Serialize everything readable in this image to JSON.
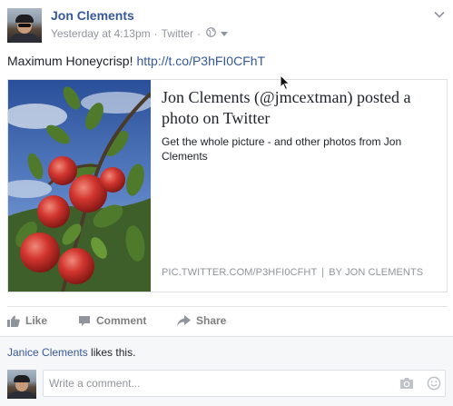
{
  "post": {
    "author": "Jon Clements",
    "timestamp": "Yesterday at 4:13pm",
    "separator": "·",
    "source": "Twitter",
    "privacy_icon": "globe-icon",
    "menu_icon": "chevron-down-icon",
    "text": "Maximum Honeycrisp!",
    "link_text": "http://t.co/P3hFI0CFhT"
  },
  "card": {
    "title": "Jon Clements (@jmcextman) posted a photo on Twitter",
    "description": "Get the whole picture - and other photos from Jon Clements",
    "source_domain": "PIC.TWITTER.COM/P3HFI0CFHT",
    "divider": "|",
    "source_author": "BY JON CLEMENTS",
    "image_icon": "apples-photo"
  },
  "actions": {
    "like": "Like",
    "comment": "Comment",
    "share": "Share"
  },
  "footer": {
    "liker": "Janice Clements",
    "likes_suffix": " likes this.",
    "comment_placeholder": "Write a comment...",
    "camera_icon": "camera-icon",
    "emoji_icon": "smiley-icon"
  },
  "colors": {
    "link": "#365899",
    "meta": "#90949c",
    "action": "#7f7f7f",
    "footer_bg": "#f6f7f9"
  }
}
